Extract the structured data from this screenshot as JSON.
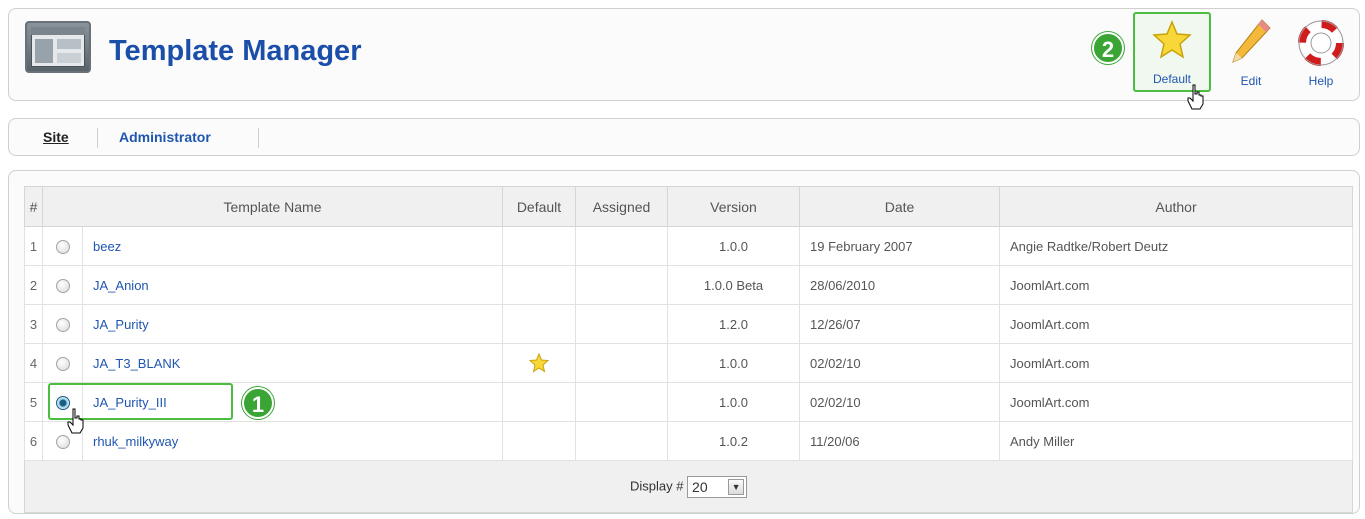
{
  "header": {
    "title": "Template Manager",
    "toolbar": {
      "default_label": "Default",
      "edit_label": "Edit",
      "help_label": "Help"
    }
  },
  "badges": {
    "step1": "1",
    "step2": "2"
  },
  "tabs": {
    "site": "Site",
    "administrator": "Administrator"
  },
  "table": {
    "headers": [
      "#",
      "Template Name",
      "Default",
      "Assigned",
      "Version",
      "Date",
      "Author"
    ],
    "rows": [
      {
        "num": "1",
        "name": "beez",
        "default": false,
        "assigned": "",
        "version": "1.0.0",
        "date": "19 February 2007",
        "author": "Angie Radtke/Robert Deutz",
        "selected": false
      },
      {
        "num": "2",
        "name": "JA_Anion",
        "default": false,
        "assigned": "",
        "version": "1.0.0 Beta",
        "date": "28/06/2010",
        "author": "JoomlArt.com",
        "selected": false
      },
      {
        "num": "3",
        "name": "JA_Purity",
        "default": false,
        "assigned": "",
        "version": "1.2.0",
        "date": "12/26/07",
        "author": "JoomlArt.com",
        "selected": false
      },
      {
        "num": "4",
        "name": "JA_T3_BLANK",
        "default": true,
        "assigned": "",
        "version": "1.0.0",
        "date": "02/02/10",
        "author": "JoomlArt.com",
        "selected": false
      },
      {
        "num": "5",
        "name": "JA_Purity_III",
        "default": false,
        "assigned": "",
        "version": "1.0.0",
        "date": "02/02/10",
        "author": "JoomlArt.com",
        "selected": true
      },
      {
        "num": "6",
        "name": "rhuk_milkyway",
        "default": false,
        "assigned": "",
        "version": "1.0.2",
        "date": "11/20/06",
        "author": "Andy Miller",
        "selected": false
      }
    ],
    "footer": {
      "display_label": "Display #",
      "display_value": "20"
    }
  },
  "colors": {
    "accent_green": "#4bbd3f",
    "link_blue": "#1f56b0",
    "title_blue": "#1a4ea8"
  }
}
